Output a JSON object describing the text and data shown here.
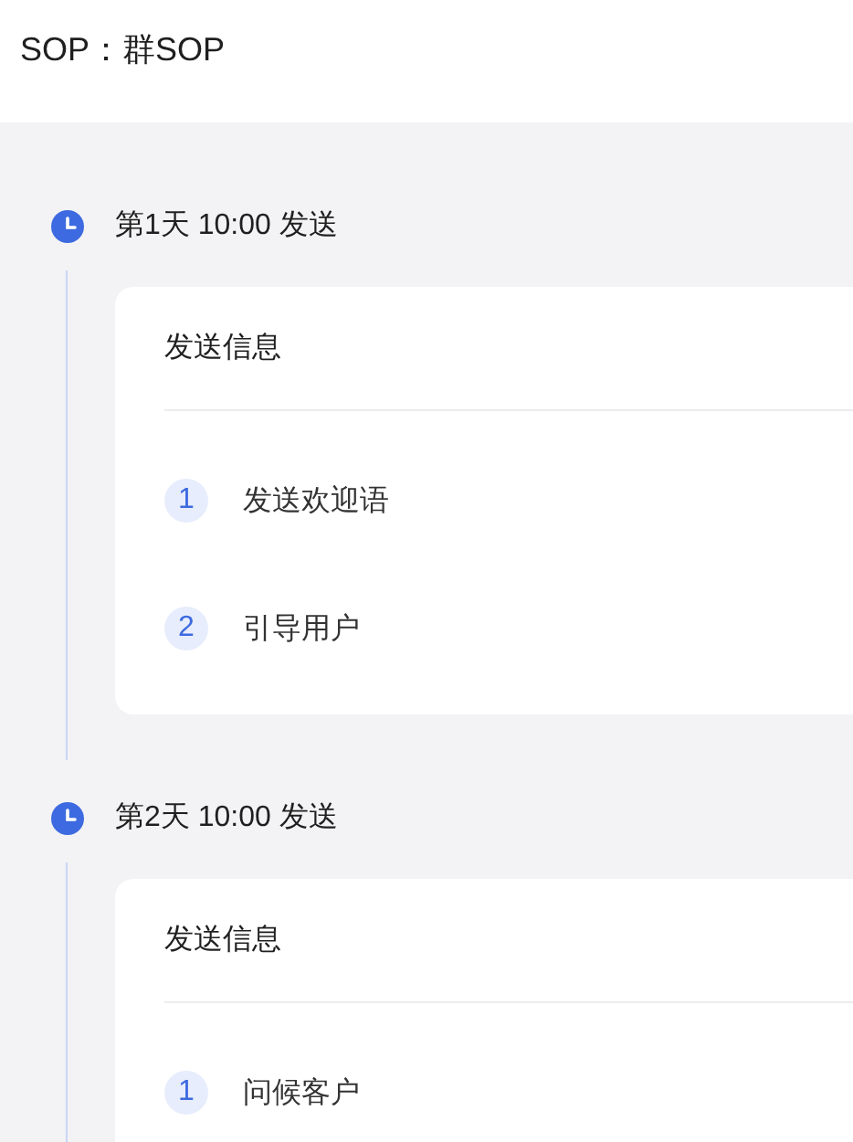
{
  "header": {
    "title": "SOP：群SOP"
  },
  "steps": [
    {
      "title": "第1天 10:00 发送",
      "card": {
        "title": "发送信息",
        "items": [
          {
            "number": "1",
            "text": "发送欢迎语"
          },
          {
            "number": "2",
            "text": "引导用户"
          }
        ]
      }
    },
    {
      "title": "第2天 10:00 发送",
      "card": {
        "title": "发送信息",
        "items": [
          {
            "number": "1",
            "text": "问候客户"
          }
        ]
      }
    }
  ]
}
